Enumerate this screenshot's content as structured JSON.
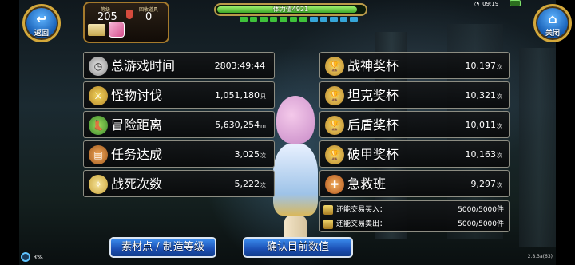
{
  "nav": {
    "back_label": "返回",
    "close_label": "关闭"
  },
  "player": {
    "level_label": "等级",
    "level_value": "205",
    "item_label": "回收道具",
    "item_value": "0"
  },
  "stamina": {
    "label": "体力值4921",
    "fill_fraction": 0.93,
    "segments": [
      "#3ec23a",
      "#3ec23a",
      "#3ec23a",
      "#3ec23a",
      "#3ec23a",
      "#3ec23a",
      "#3ec23a",
      "#36a6d8",
      "#36a6d8",
      "#36a6d8",
      "#36a6d8",
      "#36a6d8"
    ]
  },
  "status": {
    "time": "09:19"
  },
  "stats_left": [
    {
      "label": "总游戏时间",
      "value": "2803:49:44",
      "unit": "",
      "icon": "stopwatch-icon",
      "glyph": "◷"
    },
    {
      "label": "怪物讨伐",
      "value": "1,051,180",
      "unit": "只",
      "icon": "sword-icon",
      "glyph": "⚔"
    },
    {
      "label": "冒险距离",
      "value": "5,630,254",
      "unit": "m",
      "icon": "boot-icon",
      "glyph": "👢"
    },
    {
      "label": "任务达成",
      "value": "3,025",
      "unit": "次",
      "icon": "book-icon",
      "glyph": "▤"
    },
    {
      "label": "战死次数",
      "value": "5,222",
      "unit": "次",
      "icon": "wings-icon",
      "glyph": "✧"
    }
  ],
  "stats_right": [
    {
      "label": "战神奖杯",
      "value": "10,197",
      "unit": "次",
      "icon": "trophy-icon",
      "glyph": "🏆"
    },
    {
      "label": "坦克奖杯",
      "value": "10,321",
      "unit": "次",
      "icon": "trophy-icon",
      "glyph": "🏆"
    },
    {
      "label": "后盾奖杯",
      "value": "10,011",
      "unit": "次",
      "icon": "trophy-icon",
      "glyph": "🏆"
    },
    {
      "label": "破甲奖杯",
      "value": "10,163",
      "unit": "次",
      "icon": "trophy-icon",
      "glyph": "🏆"
    },
    {
      "label": "急救班",
      "value": "9,297",
      "unit": "次",
      "icon": "first-aid-icon",
      "glyph": "✚"
    }
  ],
  "trade": {
    "buy_label": "还能交易买入：",
    "buy_value": "5000/5000件",
    "sell_label": "还能交易卖出：",
    "sell_value": "5000/5000件"
  },
  "buttons": {
    "materials": "素材点 / 制造等级",
    "confirm": "确认目前数值"
  },
  "footer": {
    "progress": "3%",
    "version": "2.8.3a(63)"
  }
}
